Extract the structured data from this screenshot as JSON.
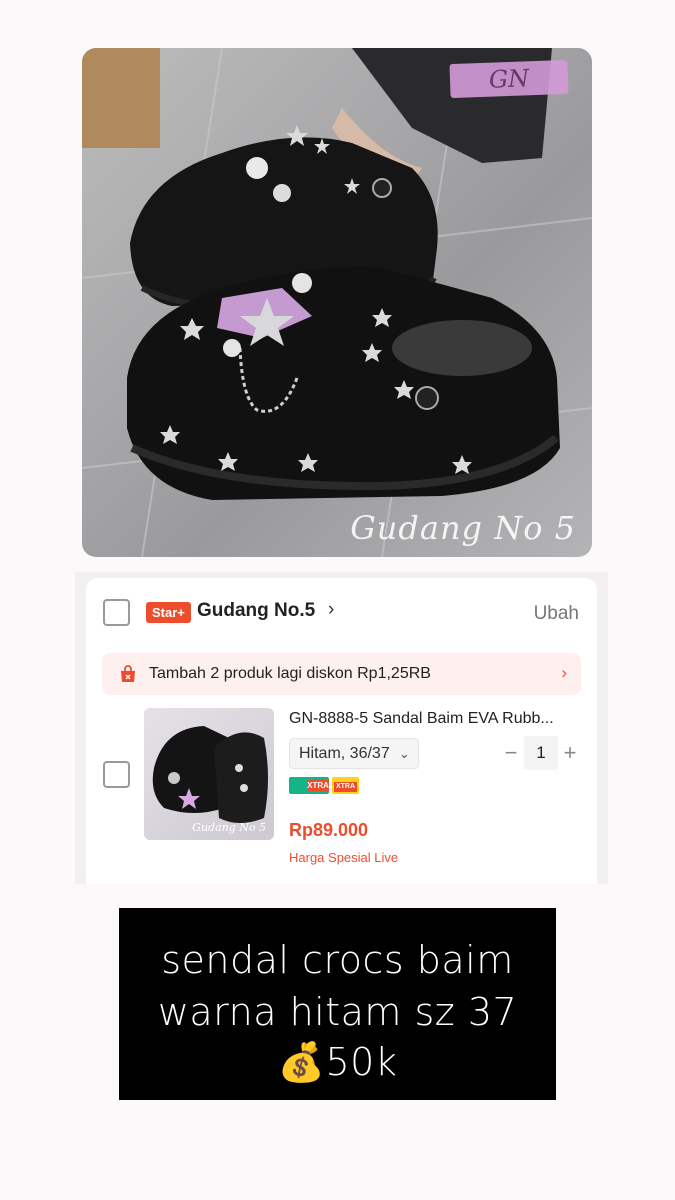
{
  "hero": {
    "watermark_tag": "GN",
    "watermark_text": "Gudang No 5"
  },
  "cart": {
    "store_badge": "Star+",
    "store_name": "Gudang No.5",
    "store_chevron": "›",
    "edit_label": "Ubah",
    "promo_text": "Tambah 2 produk lagi diskon Rp1,25RB",
    "promo_arrow": "›",
    "product": {
      "title": "GN-8888-5 Sandal Baim EVA Rubb...",
      "variant": "Hitam, 36/37",
      "variant_chevron": "⌄",
      "qty_minus": "−",
      "quantity": "1",
      "qty_plus": "+",
      "badge_1": "XTRA",
      "badge_2": "XTRA",
      "price": "Rp89.000",
      "price_note": "Harga Spesial Live",
      "thumb_watermark": "Gudang No 5"
    }
  },
  "caption": {
    "line1": "sendal crocs baim",
    "line2": "warna hitam sz 37",
    "line3": "💰50k"
  },
  "colors": {
    "accent": "#ee4d2d",
    "caption_bg": "#000000",
    "promo_bg": "#fdf0ee"
  }
}
